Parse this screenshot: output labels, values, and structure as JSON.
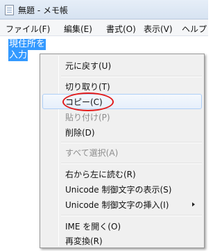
{
  "window": {
    "title": "無題 - メモ帳"
  },
  "menubar": {
    "items": [
      "ファイル(F)",
      "編集(E)",
      "書式(O)",
      "表示(V)",
      "ヘルプ"
    ]
  },
  "editor": {
    "selected_lines": [
      "現住所を",
      "入力"
    ]
  },
  "context_menu": {
    "items": [
      {
        "label": "元に戻す(U)",
        "enabled": true
      },
      {
        "label": "切り取り(T)",
        "enabled": true
      },
      {
        "label": "コピー(C)",
        "enabled": true,
        "hovered": true,
        "circled": true
      },
      {
        "label": "貼り付け(P)",
        "enabled": false
      },
      {
        "label": "削除(D)",
        "enabled": true
      },
      {
        "label": "すべて選択(A)",
        "enabled": false
      },
      {
        "label": "右から左に読む(R)",
        "enabled": true
      },
      {
        "label": "Unicode 制御文字の表示(S)",
        "enabled": true
      },
      {
        "label": "Unicode 制御文字の挿入(I)",
        "enabled": true,
        "submenu": true
      },
      {
        "label": "IME を開く(O)",
        "enabled": true
      },
      {
        "label": "再変換(R)",
        "enabled": true
      }
    ],
    "highlight_color": "#e21b1b",
    "hover_color": "#aecff7"
  }
}
